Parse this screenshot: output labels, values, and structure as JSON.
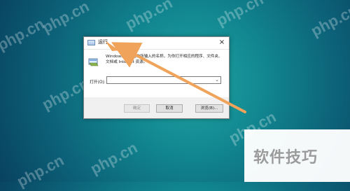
{
  "watermarks": [
    "php.cn",
    "php.cn",
    "php.cn",
    "php.cn",
    "php.cn",
    "php.cn",
    "php.cn",
    "php.cn",
    "php.cn"
  ],
  "dialog": {
    "title": "运行",
    "close_glyph": "×",
    "description": "Windows 将根据你所输入的名称，为你打开相应的程序、文件夹、文档或 Internet 资源。",
    "open_label": "打开(O):",
    "open_value": "",
    "ok_label": "确定",
    "cancel_label": "取消",
    "browse_label": "浏览(B)..."
  },
  "badge": {
    "text": "软件技巧"
  },
  "colors": {
    "arrow": "#f0a35a"
  }
}
